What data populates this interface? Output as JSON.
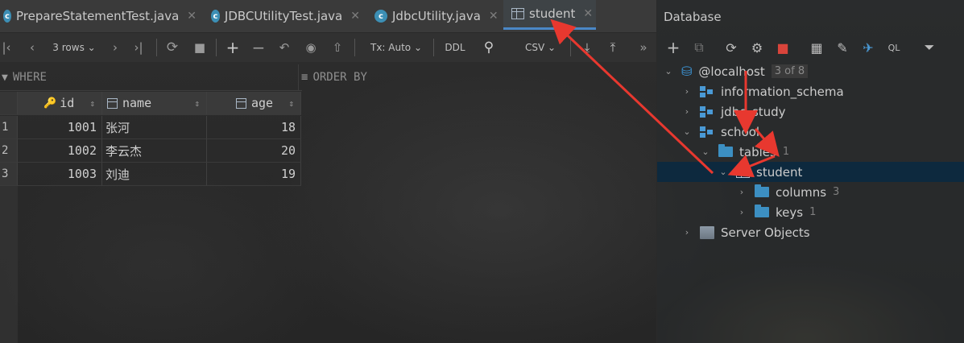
{
  "tabs": [
    {
      "label": "PrepareStatementTest.java",
      "icon": "java-class-icon"
    },
    {
      "label": "JDBCUtilityTest.java",
      "icon": "java-class-icon"
    },
    {
      "label": "JdbcUtility.java",
      "icon": "java-class-icon"
    },
    {
      "label": "student",
      "icon": "table-icon",
      "active": true
    }
  ],
  "toolbar": {
    "rows_label": "3 rows",
    "tx_label": "Tx: Auto",
    "ddl_label": "DDL",
    "export_label": "CSV"
  },
  "filter": {
    "where_label": "WHERE",
    "orderby_label": "ORDER BY"
  },
  "grid": {
    "columns": [
      "id",
      "name",
      "age"
    ],
    "rows": [
      {
        "num": "1",
        "id": "1001",
        "name": "张河",
        "age": "18"
      },
      {
        "num": "2",
        "id": "1002",
        "name": "李云杰",
        "age": "20"
      },
      {
        "num": "3",
        "id": "1003",
        "name": "刘迪",
        "age": "19"
      }
    ]
  },
  "db": {
    "title": "Database",
    "host": "@localhost",
    "host_badge": "3 of 8",
    "info_schema": "information_schema",
    "jdbc_study": "jdbc_study",
    "school": "school",
    "tables": "tables",
    "tables_count": "1",
    "student": "student",
    "columns": "columns",
    "columns_count": "3",
    "keys": "keys",
    "keys_count": "1",
    "server_objects": "Server Objects"
  },
  "colors": {
    "accent": "#4a88c7",
    "selection": "#0d293e",
    "folder": "#3c8fc2",
    "annotation": "#e8382f"
  }
}
